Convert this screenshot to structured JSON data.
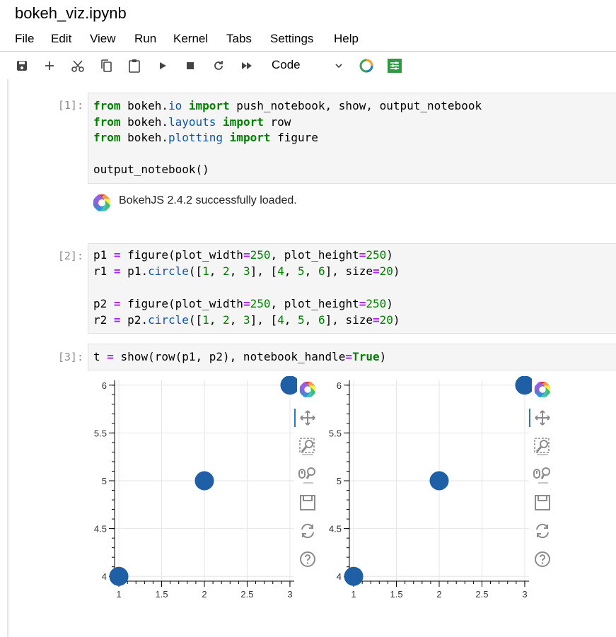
{
  "title": "bokeh_viz.ipynb",
  "menu": [
    "File",
    "Edit",
    "View",
    "Run",
    "Kernel",
    "Tabs",
    "Settings",
    "Help"
  ],
  "toolbar": {
    "cell_type": "Code",
    "icons": [
      "save-icon",
      "plus-icon",
      "scissors-icon",
      "copy-icon",
      "paste-icon",
      "play-icon",
      "stop-icon",
      "restart-icon",
      "fast-forward-icon"
    ]
  },
  "cells": [
    {
      "prompt": "[1]:"
    },
    {
      "prompt": "[2]:"
    },
    {
      "prompt": "[3]:"
    }
  ],
  "output1": {
    "text": "BokehJS 2.4.2 successfully loaded."
  },
  "chart_data": [
    {
      "type": "scatter",
      "x": [
        1,
        2,
        3
      ],
      "y": [
        4,
        5,
        6
      ],
      "xlim": [
        0.95,
        3.05
      ],
      "ylim": [
        3.95,
        6.05
      ],
      "xticks": [
        "1",
        "1.5",
        "2",
        "2.5",
        "3"
      ],
      "yticks": [
        "4",
        "4.5",
        "5",
        "5.5",
        "6"
      ],
      "marker_color": "#1f5fa6",
      "grid": true
    },
    {
      "type": "scatter",
      "x": [
        1,
        2,
        3
      ],
      "y": [
        4,
        5,
        6
      ],
      "xlim": [
        0.95,
        3.05
      ],
      "ylim": [
        3.95,
        6.05
      ],
      "xticks": [
        "1",
        "1.5",
        "2",
        "2.5",
        "3"
      ],
      "yticks": [
        "4",
        "4.5",
        "5",
        "5.5",
        "6"
      ],
      "marker_color": "#1f5fa6",
      "grid": true
    }
  ]
}
